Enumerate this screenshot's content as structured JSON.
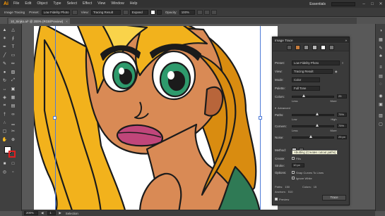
{
  "menubar": {
    "logo": "Ai",
    "items": [
      "File",
      "Edit",
      "Object",
      "Type",
      "Select",
      "Effect",
      "View",
      "Window",
      "Help"
    ],
    "workspace": "Essentials",
    "window_buttons": [
      "–",
      "□",
      "✕"
    ]
  },
  "controlbar": {
    "label_selection": "Image Tracing",
    "preset_label": "Preset:",
    "preset_value": "Low Fidelity Photo",
    "view_label": "View:",
    "view_value": "Tracing Result",
    "expand_label": "Expand",
    "opacity_label": "Opacity:",
    "opacity_value": "100%"
  },
  "tab": {
    "title": "10_Sinjko.ai* @ 200% (RGB/Preview)",
    "close": "×"
  },
  "status": {
    "zoom": "200%",
    "page": "1",
    "info": "Selection"
  },
  "panel": {
    "title": "Image Trace",
    "close": "»",
    "preset_label": "Preset:",
    "preset_value": "Low Fidelity Photo",
    "view_label": "View:",
    "view_value": "Tracing Result",
    "mode_label": "Mode:",
    "mode_value": "Color",
    "palette_label": "Palette:",
    "palette_value": "Full Tone",
    "colors_label": "Colors:",
    "colors_value": "25",
    "colors_level": 0.28,
    "less_label": "Less",
    "more_label": "More",
    "advanced_label": "Advanced",
    "paths_label": "Paths:",
    "paths_value": "75%",
    "paths_level": 0.62,
    "paths_low": "Low",
    "paths_high": "High",
    "corners_label": "Corners:",
    "corners_value": "75%",
    "corners_level": 0.62,
    "corners_less": "Less",
    "corners_more": "More",
    "noise_label": "Noise:",
    "noise_value": "25 px",
    "noise_level": 0.45,
    "method_label": "Method:",
    "create_label": "Create:",
    "fills_label": "Fills",
    "stroke_label": "Stroke:",
    "stroke_value": "10 px",
    "options_label": "Options:",
    "snap_label": "Snap Curves To Lines",
    "ignore_label": "Ignore White",
    "paths_stat_label": "Paths:",
    "paths_stat": "150",
    "anchors_stat_label": "Anchors:",
    "anchors_stat": "510",
    "colors_stat_label": "Colors:",
    "colors_stat": "15",
    "preview_label": "Preview",
    "trace_button": "Trace"
  },
  "tooltip": "Abutting (Creates cutout paths)",
  "colors": {
    "hair": "#f2b21c",
    "hair_light": "#f9d34a",
    "hair_dark": "#d98c10",
    "skin": "#d98a55",
    "skin_shadow": "#b8653a",
    "eye_green": "#2e9a6c",
    "lips": "#c0467a",
    "shirt": "#2f7a55",
    "outline": "#1b1b1b"
  }
}
